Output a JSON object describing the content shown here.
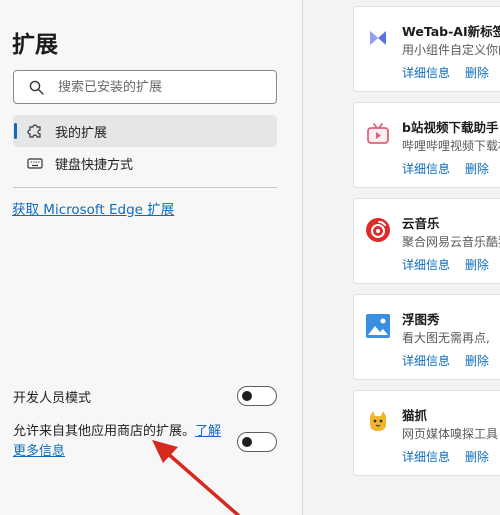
{
  "sidebar": {
    "title": "扩展",
    "search_placeholder": "搜索已安装的扩展",
    "nav": [
      {
        "label": "我的扩展"
      },
      {
        "label": "键盘快捷方式"
      }
    ],
    "get_link": "获取 Microsoft Edge 扩展",
    "dev_mode": {
      "label": "开发人员模式",
      "enabled": false
    },
    "allow_other_stores": {
      "label": "允许来自其他应用商店的扩展。",
      "link": "了解更多信息",
      "enabled": false
    }
  },
  "extensions": [
    {
      "name": "WeTab-AI新标签页",
      "desc": "用小组件自定义你的",
      "details": "详细信息",
      "remove": "删除",
      "icon": "wetab-icon"
    },
    {
      "name": "b站视频下载助手 -",
      "desc": "哔哩哔哩视频下载相",
      "details": "详细信息",
      "remove": "删除",
      "icon": "tv-icon"
    },
    {
      "name": "云音乐",
      "desc": "聚合网易云音乐酷狗",
      "details": "详细信息",
      "remove": "删除",
      "icon": "music-icon"
    },
    {
      "name": "浮图秀",
      "desc": "看大图无需再点,",
      "details": "详细信息",
      "remove": "删除",
      "icon": "image-icon"
    },
    {
      "name": "猫抓",
      "desc": "网页媒体嗅探工具",
      "details": "详细信息",
      "remove": "删除",
      "icon": "cat-icon"
    }
  ],
  "colors": {
    "accent": "#0f6cbd",
    "annotation_arrow": "#d42a1f"
  }
}
